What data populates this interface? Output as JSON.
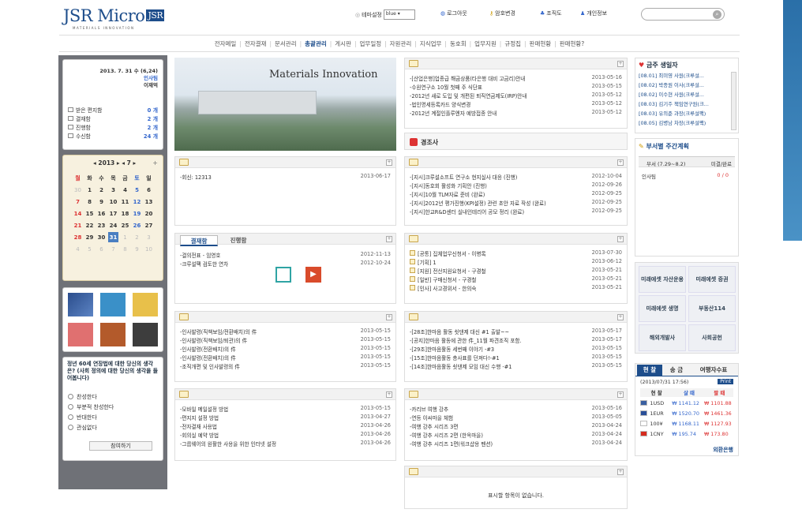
{
  "brand": {
    "name": "JSR Micro",
    "box": "JSR",
    "tagline": "MATERIALS INNOVATION"
  },
  "util": {
    "theme_label": "테마설정",
    "theme_value": "blue",
    "logout": "로그아웃",
    "password": "암호변경",
    "org": "조직도",
    "profile": "개인정보"
  },
  "search": {
    "placeholder": ""
  },
  "gnb": [
    "전자메일",
    "전자결재",
    "문서관리",
    "총괄관리",
    "게시판",
    "업무일정",
    "자원관리",
    "지식업무",
    "동호회",
    "업무지원",
    "규정집",
    "판매현황",
    "판매현황?"
  ],
  "user": {
    "date": "2013. 7. 31 수 (6,24)",
    "role": "인사팀",
    "name": "이재억",
    "stats": [
      {
        "label": "받은 편지함",
        "value": "0 개"
      },
      {
        "label": "결재함",
        "value": "2 개"
      },
      {
        "label": "진행함",
        "value": "2 개"
      },
      {
        "label": "수신함",
        "value": "24 개"
      }
    ]
  },
  "calendar": {
    "title": "◂ 2013 ▸ ◂ 7 ▸",
    "plus": "+",
    "days": [
      "월",
      "화",
      "수",
      "목",
      "금",
      "토",
      "일"
    ],
    "weeks": [
      [
        "30",
        "1",
        "2",
        "3",
        "4",
        "5",
        "6"
      ],
      [
        "7",
        "8",
        "9",
        "10",
        "11",
        "12",
        "13"
      ],
      [
        "14",
        "15",
        "16",
        "17",
        "18",
        "19",
        "20"
      ],
      [
        "21",
        "22",
        "23",
        "24",
        "25",
        "26",
        "27"
      ],
      [
        "28",
        "29",
        "30",
        "31",
        "1",
        "2",
        "3"
      ],
      [
        "4",
        "5",
        "6",
        "7",
        "8",
        "9",
        "10"
      ]
    ]
  },
  "poll": {
    "question": "정년 60세 연장법에 대한 당신의 생각은? (사회 정의에 대한 당신의 생각을 들어봅니다)",
    "options": [
      "찬성한다",
      "부분적 찬성한다",
      "반대한다",
      "관심없다"
    ],
    "submit": "참여하기"
  },
  "hero": {
    "caption": "Materials Innovation"
  },
  "notice": {
    "items": [
      {
        "t": "-[산업은행]업종급 해금상품(타은행 대비 고금리)안내",
        "d": "2013-05-16"
      },
      {
        "t": "-수원연구소 10월 첫째 주 식단표",
        "d": "2013-05-15"
      },
      {
        "t": "-2012년 새로 도입 및 개편된 퇴직연금제도(IRP)안내",
        "d": "2013-05-12"
      },
      {
        "t": "-법인명세등록카드 양식변경",
        "d": "2013-05-12"
      },
      {
        "t": "-2012년 계절인플루엔자 예방접종 안내",
        "d": "2013-05-12"
      }
    ]
  },
  "ceremony": {
    "label": "경조사"
  },
  "mini1": {
    "items": [
      {
        "t": "-회신: 12313",
        "d": "2013-06-17"
      }
    ]
  },
  "notice2": {
    "items": [
      {
        "t": "-[지시]크루설소프트 연구소 현지실사 대응 (진행)",
        "d": "2012-10-04"
      },
      {
        "t": "-[지시]동호회 활성화 기획안 (진행)",
        "d": "2012-09-26"
      },
      {
        "t": "-[지시]10월 TLM자료 준비 (완료)",
        "d": "2012-09-25"
      },
      {
        "t": "-[지시]2012년 평가진행(KPI설정) 관련 초안 자료 작성 (완료)",
        "d": "2012-09-25"
      },
      {
        "t": "-[지시]한교R&D센터 실내인테리어 공모 정리 (완료)",
        "d": "2012-09-25"
      }
    ]
  },
  "approval": {
    "tabs": [
      "결재함",
      "진행함"
    ],
    "items": [
      {
        "t": "-결의전표 - 임영호",
        "d": "2012-11-13"
      },
      {
        "t": "-크루설팩 검토한 연차",
        "d": "2012-10-24"
      }
    ]
  },
  "docs": {
    "items": [
      {
        "t": "[공통] 집체업무신청서 - 이병록",
        "d": "2013-07-30"
      },
      {
        "t": "[기획] 1",
        "d": "2013-06-12"
      },
      {
        "t": "[지원] 전산지원요청서 - 구경철",
        "d": "2013-05-21"
      },
      {
        "t": "[일반] 구매신청서 - 구경철",
        "d": "2013-05-21"
      },
      {
        "t": "[인사] 사고경위서 - 한의숙",
        "d": "2013-05-21"
      }
    ]
  },
  "hr": {
    "items": [
      {
        "t": "-인사발령(직책보임/전환배치)의 件",
        "d": "2013-05-15"
      },
      {
        "t": "-인사발령(직책보임/퇴관)의 件",
        "d": "2013-05-15"
      },
      {
        "t": "-인사발령(전환배치)의 件",
        "d": "2013-05-15"
      },
      {
        "t": "-인사발령(전환배치)의 件",
        "d": "2013-05-15"
      },
      {
        "t": "-조직개편 및 인사발령의 件",
        "d": "2013-05-15"
      }
    ]
  },
  "club": {
    "items": [
      {
        "t": "-[28조]한마음 활동 쇳댄제 대신 #1 출발~~",
        "d": "2013-05-17"
      },
      {
        "t": "-[공지]한마음 활동에 관한 件_11월 파견조직 포함.",
        "d": "2013-05-17"
      },
      {
        "t": "-[29조]한마음활동 세번째 이야기 -#3",
        "d": "2013-05-15"
      },
      {
        "t": "-[15조]한마음활동 총사표를 던져다!-#1",
        "d": "2013-05-15"
      },
      {
        "t": "-[14조]한마음활동 쇳댄제 모임 대신 수행 -#1",
        "d": "2013-05-15"
      }
    ]
  },
  "guide": {
    "items": [
      {
        "t": "-모바일 메일설정 방법",
        "d": "2013-05-15"
      },
      {
        "t": "-편지지 설정 방법",
        "d": "2013-04-27"
      },
      {
        "t": "-전자결재 사용법",
        "d": "2013-04-26"
      },
      {
        "t": "-회의실 예약 방법",
        "d": "2013-04-26"
      },
      {
        "t": "-그룹웨어의 원활한 사용을 위한 인터넷 설정",
        "d": "2013-04-26"
      }
    ]
  },
  "travel": {
    "items": [
      {
        "t": "-카리브 여행 강추",
        "d": "2013-05-16"
      },
      {
        "t": "-연등 이씨마을 체험",
        "d": "2013-05-05"
      },
      {
        "t": "-여행 강추 시리즈 3편",
        "d": "2013-04-24"
      },
      {
        "t": "-여행 강추 시리즈 2편 (한옥마을)",
        "d": "2013-04-24"
      },
      {
        "t": "-여행 강추 시리즈 1편(워크샵용 펜션)",
        "d": "2013-04-24"
      }
    ]
  },
  "empty": {
    "text": "표시할 항목이 없습니다."
  },
  "birthday": {
    "title": "금주 생일자",
    "items": [
      "[08.01] 최미영 사원(크루설...",
      "[08.02] 박종원 이사(크루설...",
      "[08.02] 이수현 사원(크루설...",
      "[08.03] 김기주 책임연구원(크...",
      "[08.03] 유의준 과장(크루설팩)",
      "[08.05] 김병남 차장(크루설팩)"
    ]
  },
  "weekly": {
    "title": "부서별 주간계획",
    "col1": "부서 (7.29~8.2)",
    "col2": "미결/완료",
    "dept": "인사팀",
    "value": "0 / 0"
  },
  "links": [
    "미래에셋 자산운용",
    "미래에셋 증권",
    "미래에셋 생명",
    "부동산114",
    "해외개발사",
    "사회공헌"
  ],
  "fx": {
    "tabs": [
      "현 찰",
      "송 금",
      "여행자수표"
    ],
    "stamp": "(2013/07/31 17:56)",
    "print": "Print",
    "head": [
      "현 찰",
      "살 때",
      "팔 때"
    ],
    "rows": [
      {
        "cur": "1USD",
        "buy": "₩ 1141.12",
        "sell": "₩ 1101.88"
      },
      {
        "cur": "1EUR",
        "buy": "₩ 1520.70",
        "sell": "₩ 1461.36"
      },
      {
        "cur": "100¥",
        "buy": "₩ 1168.11",
        "sell": "₩ 1127.93"
      },
      {
        "cur": "1CNY",
        "buy": "₩ 195.74",
        "sell": "₩ 173.80"
      }
    ],
    "footer": "외환은행"
  },
  "colors": {
    "brand": "#1d4d8b",
    "accent": "#4a7fc1",
    "red": "#d33"
  }
}
